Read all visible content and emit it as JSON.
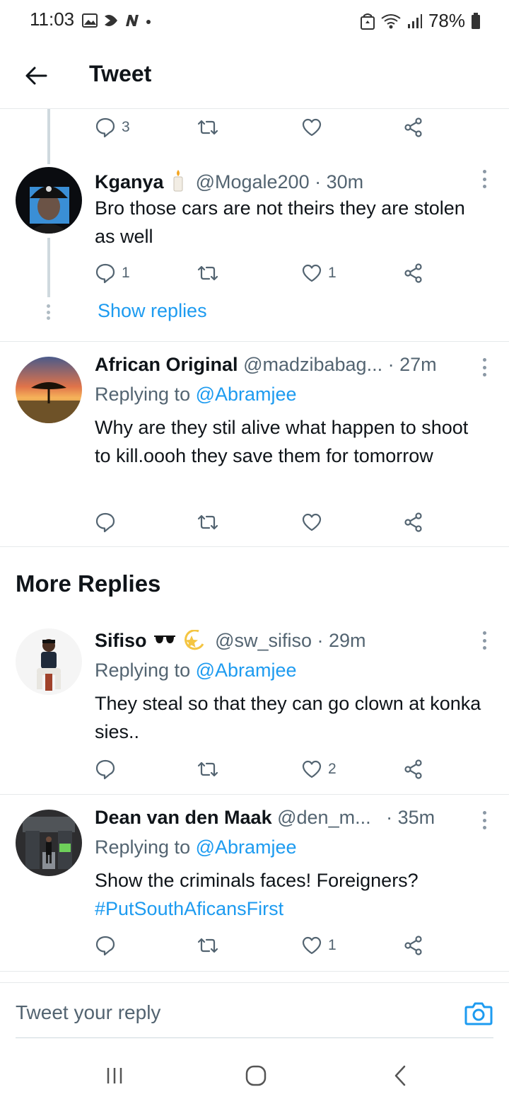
{
  "status_bar": {
    "time": "11:03",
    "battery": "78%"
  },
  "header": {
    "title": "Tweet"
  },
  "top_action_row": {
    "reply_count": "3"
  },
  "tweets": [
    {
      "name": "Kganya",
      "handle": "@Mogale200",
      "time": "· 30m",
      "text": "Bro those cars are not theirs they are stolen as well",
      "reply_count": "1",
      "like_count": "1",
      "show_replies": "Show replies"
    },
    {
      "name": "African Original",
      "handle": "@madzibabag...",
      "time": "· 27m",
      "replying_prefix": "Replying to",
      "replying_to": "@Abramjee",
      "text": "Why are they stil alive what happen to shoot to kill.oooh they save them for tomorrow"
    }
  ],
  "more_replies": {
    "title": "More Replies",
    "tweets": [
      {
        "name": "Sifiso",
        "name_emoji": "🕶⭐",
        "handle": "@sw_sifiso",
        "time": "· 29m",
        "replying_prefix": "Replying to",
        "replying_to": "@Abramjee",
        "text": "They steal so that they can go clown at konka sies..",
        "like_count": "2"
      },
      {
        "name": "Dean van den Maak",
        "handle": "@den_m...",
        "time": "· 35m",
        "replying_prefix": "Replying to",
        "replying_to": "@Abramjee",
        "text": "Show the criminals faces! Foreigners?",
        "hashtag": "#PutSouthAficansFirst",
        "like_count": "1"
      }
    ]
  },
  "composer": {
    "placeholder": "Tweet your reply"
  },
  "icons": {
    "reply": "reply-icon",
    "retweet": "retweet-icon",
    "like": "heart-icon",
    "share": "share-icon",
    "back": "arrow-left-icon",
    "camera": "camera-icon"
  },
  "colors": {
    "accent": "#1d9bf0",
    "text": "#0f1419",
    "muted": "#536471",
    "divider": "#e6e9eb"
  }
}
